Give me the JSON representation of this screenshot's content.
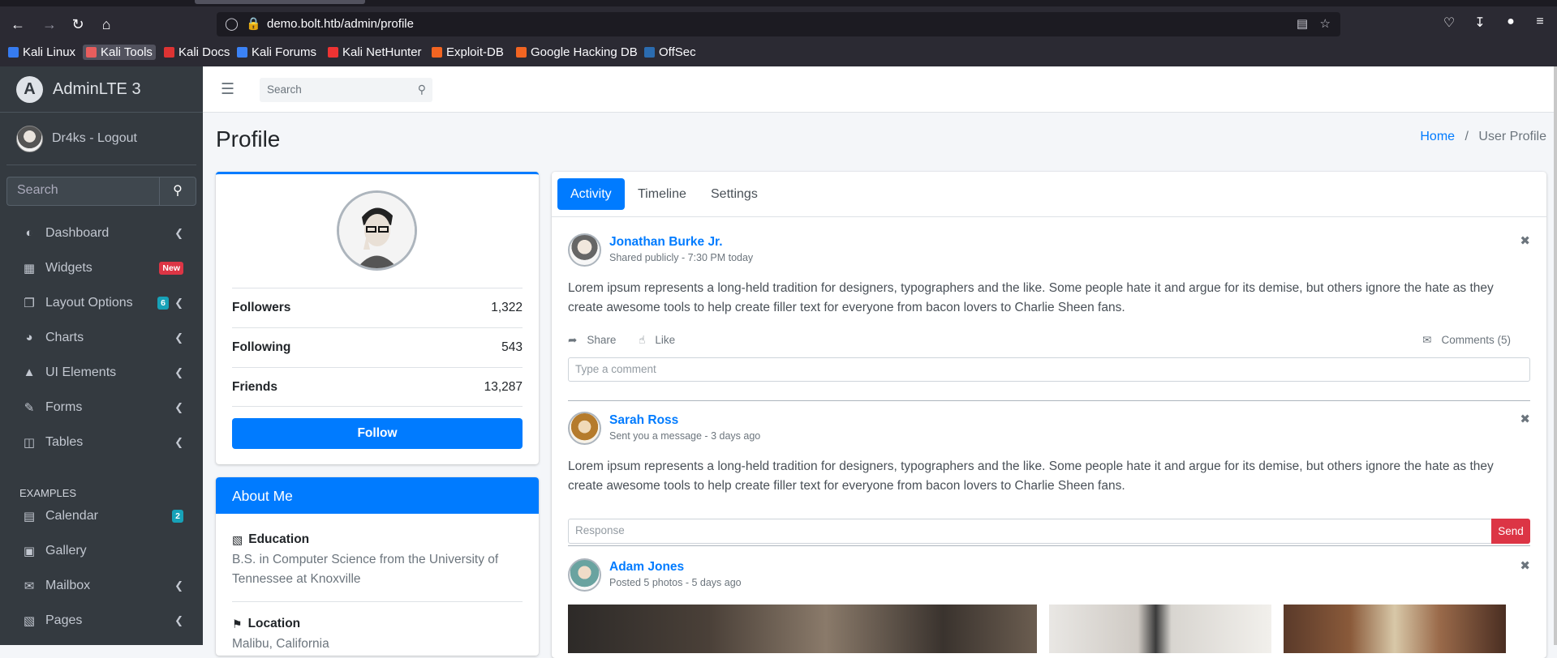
{
  "browser": {
    "url_host": "demo.bolt.htb",
    "url_path": "/admin/profile",
    "bookmarks": [
      {
        "label": "Kali Linux",
        "color": "#367bf0"
      },
      {
        "label": "Kali Tools",
        "color": "#e85d5d"
      },
      {
        "label": "Kali Docs",
        "color": "#d33"
      },
      {
        "label": "Kali Forums",
        "color": "#3b82f6"
      },
      {
        "label": "Kali NetHunter",
        "color": "#e33"
      },
      {
        "label": "Exploit-DB",
        "color": "#f26522"
      },
      {
        "label": "Google Hacking DB",
        "color": "#f26522"
      },
      {
        "label": "OffSec",
        "color": "#2b6cb0"
      }
    ]
  },
  "sidebar": {
    "brand": "AdminLTE 3",
    "user": "Dr4ks - Logout",
    "search_placeholder": "Search",
    "items": [
      {
        "label": "Dashboard",
        "icon": "tachometer-icon"
      },
      {
        "label": "Widgets",
        "icon": "grid-icon",
        "badge": "New",
        "badge_color": "#dc3545"
      },
      {
        "label": "Layout Options",
        "icon": "copy-icon",
        "badge": "6",
        "badge_color": "#17a2b8"
      },
      {
        "label": "Charts",
        "icon": "pie-chart-icon"
      },
      {
        "label": "UI Elements",
        "icon": "tree-icon"
      },
      {
        "label": "Forms",
        "icon": "edit-icon"
      },
      {
        "label": "Tables",
        "icon": "table-icon"
      }
    ],
    "examples_header": "EXAMPLES",
    "examples": [
      {
        "label": "Calendar",
        "icon": "calendar-icon",
        "badge": "2",
        "badge_color": "#17a2b8"
      },
      {
        "label": "Gallery",
        "icon": "image-icon"
      },
      {
        "label": "Mailbox",
        "icon": "envelope-icon"
      },
      {
        "label": "Pages",
        "icon": "book-icon"
      }
    ]
  },
  "navbar": {
    "search_placeholder": "Search"
  },
  "header": {
    "title": "Profile",
    "crumb_home": "Home",
    "crumb_sep": "/",
    "crumb_current": "User Profile"
  },
  "profile": {
    "stats": [
      {
        "label": "Followers",
        "value": "1,322"
      },
      {
        "label": "Following",
        "value": "543"
      },
      {
        "label": "Friends",
        "value": "13,287"
      }
    ],
    "follow_label": "Follow"
  },
  "about": {
    "title": "About Me",
    "education_title": "Education",
    "education_text": "B.S. in Computer Science from the University of Tennessee at Knoxville",
    "location_title": "Location",
    "location_text": "Malibu, California"
  },
  "tabs": [
    "Activity",
    "Timeline",
    "Settings"
  ],
  "posts": [
    {
      "user": "Jonathan Burke Jr.",
      "desc": "Shared publicly - 7:30 PM today",
      "text": "Lorem ipsum represents a long-held tradition for designers, typographers and the like. Some people hate it and argue for its demise, but others ignore the hate as they create awesome tools to help create filler text for everyone from bacon lovers to Charlie Sheen fans.",
      "share": "Share",
      "like": "Like",
      "comments": "Comments (5)",
      "comment_placeholder": "Type a comment"
    },
    {
      "user": "Sarah Ross",
      "desc": "Sent you a message - 3 days ago",
      "text": "Lorem ipsum represents a long-held tradition for designers, typographers and the like. Some people hate it and argue for its demise, but others ignore the hate as they create awesome tools to help create filler text for everyone from bacon lovers to Charlie Sheen fans.",
      "response_placeholder": "Response",
      "send": "Send"
    },
    {
      "user": "Adam Jones",
      "desc": "Posted 5 photos - 5 days ago"
    }
  ]
}
